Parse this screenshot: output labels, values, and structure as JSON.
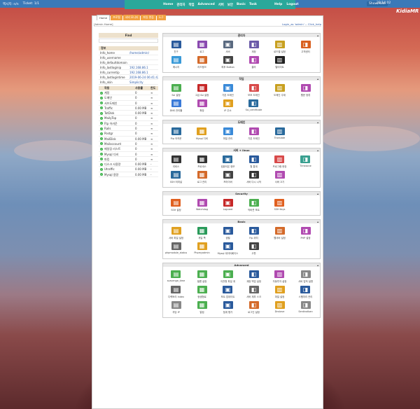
{
  "topbar": {
    "left1": "엑시지: n/n",
    "left2": "Ticket: 1/1",
    "center": [
      "Home",
      "관리자",
      "작업",
      "Advanced",
      "서버",
      "보안",
      "Basic",
      "Task"
    ],
    "help": "Help",
    "logout": "Logout",
    "showhide": "Show/Hide",
    "time": "22:14:02"
  },
  "logo": "KidiaMR",
  "tabs": [
    "Home",
    "프로필",
    "서버 모니터",
    "파일 편집",
    "도구"
  ],
  "header": {
    "left": "[Admin Home]",
    "right": "Login_as 'admin' -- Click_help"
  },
  "find": {
    "title": "Find"
  },
  "info": {
    "title": "정보",
    "rows": [
      [
        "Info_home",
        "/home/admin/"
      ],
      [
        "Info_username",
        ""
      ],
      [
        "Info_defaultdomain",
        ""
      ],
      [
        "Info_lastloginip",
        "192.168.86.1"
      ],
      [
        "Info_currentip",
        "192.168.86.1"
      ],
      [
        "Info_lastlogintime",
        "2019-06-24 06:41:42"
      ],
      [
        "Info_skin",
        "Simplicity"
      ]
    ]
  },
  "services": {
    "headers": [
      "작동",
      "사용률",
      "한도"
    ],
    "rows": [
      [
        "계정",
        "0",
        "∞"
      ],
      [
        "도메인",
        "0",
        "∞"
      ],
      [
        "서브도메인",
        "0",
        "∞"
      ],
      [
        "Traffic",
        "0.00 MB",
        "∞"
      ],
      [
        "TotDisk",
        "0.00 MB",
        "∞"
      ],
      [
        "MailyTop",
        "0",
        "∞"
      ],
      [
        "Ftp 어카운",
        "0",
        "∞"
      ],
      [
        "Rails",
        "0",
        "∞"
      ],
      [
        "Postgr",
        "0",
        "∞"
      ],
      [
        "MailDisk",
        "0.00 MB",
        "∞"
      ],
      [
        "Mailaccount",
        "0",
        "∞"
      ],
      [
        "메일링 리스트",
        "0",
        "∞"
      ],
      [
        "Mysql 디비",
        "0",
        "∞"
      ],
      [
        "파킹",
        "0",
        "∞"
      ],
      [
        "디스크 사용량",
        "0.00 MB",
        "-"
      ],
      [
        "Utraffic",
        "0.00 MB",
        "-"
      ],
      [
        "Mysql 용량",
        "0.00 MB",
        "-"
      ]
    ]
  },
  "panels": [
    {
      "title": "관리자",
      "items": [
        [
          "친구",
          "#2a5a9c"
        ],
        [
          "로그",
          "#8a4ab0"
        ],
        [
          "서버",
          "#5a6a80"
        ],
        [
          "계정",
          "#6a5aa8"
        ],
        [
          "로드밸 설정",
          "#c8a020"
        ],
        [
          "고객센터",
          "#d96020"
        ],
        [
          "메시지",
          "#3a9ad8"
        ],
        [
          "리드랭크",
          "#d46a2a"
        ],
        [
          "최후 Button",
          "#444"
        ],
        [
          "클라",
          "#b04ab0"
        ],
        [
          "멀티미트",
          "#222"
        ]
      ]
    },
    {
      "title": "작업",
      "items": [
        [
          "Ssl 설정",
          "#4caf50"
        ],
        [
          "고급 Ssl 설정",
          "#c62828"
        ],
        [
          "기본 도메인",
          "#3a8ad8"
        ],
        [
          "보조 도메인",
          "#d84a4a"
        ],
        [
          "도메인 주재",
          "#c8a020"
        ],
        [
          "웹문 정류",
          "#b04ab0"
        ],
        [
          "DNS 관리툴",
          "#3a7ad8"
        ],
        [
          "확장",
          "#b04ab0"
        ],
        [
          "IP 주소",
          "#e0a020"
        ],
        [
          "Ssl_certificate",
          "#2a6a9c"
        ]
      ]
    },
    {
      "title": "도메인",
      "items": [
        [
          "Ftp 어카운",
          "#2a6a9c"
        ],
        [
          "Mysql 디비",
          "#e0a020"
        ],
        [
          "파일 관리",
          "#3a8ad8"
        ],
        [
          "기본 도메인",
          "#b04ab0"
        ],
        [
          "Translate",
          "#2a6a9c"
        ]
      ]
    },
    {
      "title": "서버 + linux",
      "items": [
        [
          "리비스",
          "#333"
        ],
        [
          "프로세스",
          "#333"
        ],
        [
          "컴퓨터온 정보",
          "#2a6a9c"
        ],
        [
          "월 통계",
          "#2a5a9c"
        ],
        [
          "프로그램 현장",
          "#d84a4a"
        ],
        [
          "Timezone",
          "#3aa090"
        ],
        [
          "SSH 터미널",
          "#2a6a9c"
        ],
        [
          "로그 관리",
          "#d46a2a"
        ],
        [
          "프라이버",
          "#444"
        ],
        [
          "서버 다시 시작",
          "#333"
        ],
        [
          "서버 끄기",
          "#b04ab0"
        ]
      ]
    },
    {
      "title": "Security",
      "items": [
        [
          "SSH 설정",
          "#e06020"
        ],
        [
          "Watchdog",
          "#b04ab0"
        ],
        [
          "Lsguard",
          "#c62828"
        ],
        [
          "막바웃 포트",
          "#4caf50"
        ],
        [
          "SSH Keys",
          "#e06020"
        ]
      ]
    },
    {
      "title": "Basic",
      "items": [
        [
          "서버 파일 설정",
          "#e0a020"
        ],
        [
          "게일 쪽",
          "#2a9a5a"
        ],
        [
          "생필",
          "#2a5a9c"
        ],
        [
          "Ftp 위치",
          "#2a5a9c"
        ],
        [
          "웹서버 설정",
          "#d46a2a"
        ],
        [
          "PHP 설정",
          "#b04ab0"
        ],
        [
          "phpmodule_status",
          "#666"
        ],
        [
          "Phpmyadmin",
          "#e0a020"
        ],
        [
          "Mysql 데이터베이스",
          "#2a5a9c"
        ],
        [
          "고판",
          "#444"
        ]
      ]
    },
    {
      "title": "Advanced",
      "items": [
        [
          "scavenge_time",
          "#4caf50"
        ],
        [
          "필름 설정",
          "#4caf50"
        ],
        [
          "이관형 파일 계",
          "#4caf50"
        ],
        [
          "계정 백업 설정",
          "#2a5a9c"
        ],
        [
          "자동투자 설정",
          "#b04ab0"
        ],
        [
          "서버 업적 설명",
          "#888"
        ],
        [
          "디렉토리 Index",
          "#666"
        ],
        [
          "쌍생형료",
          "#4caf50"
        ],
        [
          "포트 업데이트",
          "#2a5a9c"
        ],
        [
          "서버 재부 스크",
          "#666"
        ],
        [
          "파일 설정",
          "#e0a020"
        ],
        [
          "스팸처리 관리",
          "#2a5a9c"
        ],
        [
          "자당 IP",
          "#888"
        ],
        [
          "알림",
          "#4caf50"
        ],
        [
          "첨계 평가",
          "#2a5a9c"
        ],
        [
          "로그인 설정",
          "#d46a2a"
        ],
        [
          "Dnslave",
          "#e0a020"
        ],
        [
          "Sentinalban",
          "#888"
        ]
      ]
    }
  ]
}
